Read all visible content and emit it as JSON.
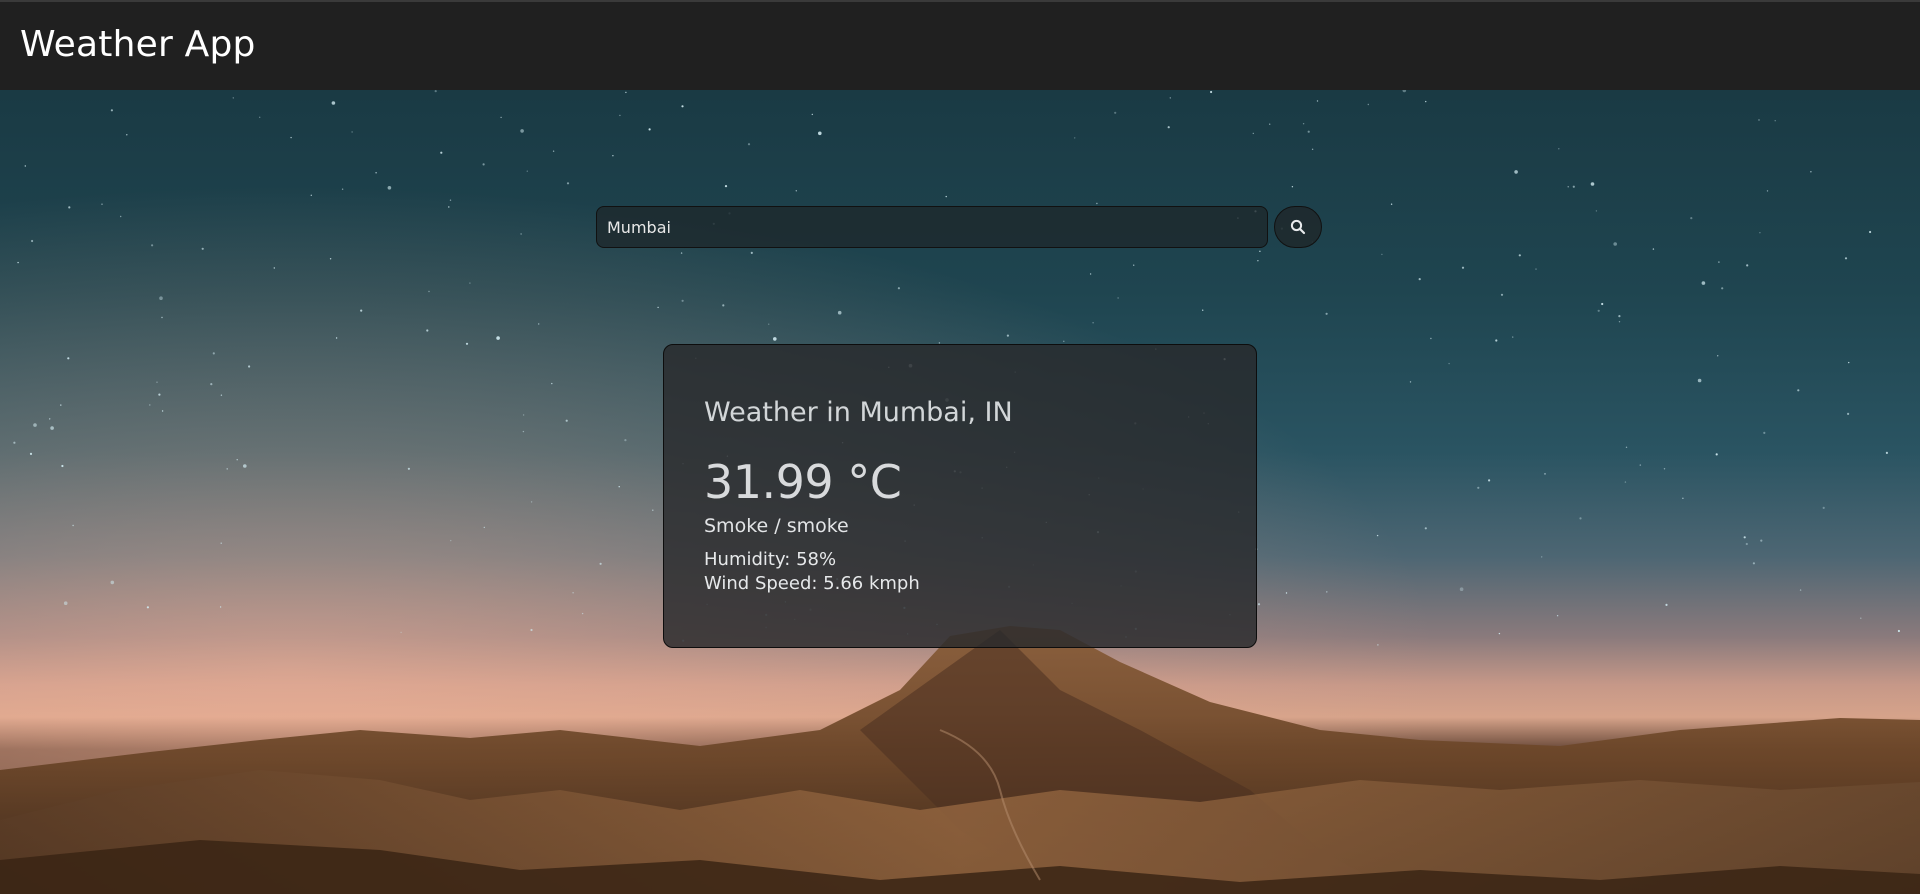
{
  "header": {
    "title": "Weather App"
  },
  "search": {
    "value": "Mumbai",
    "button_icon": "search-icon"
  },
  "weather": {
    "title": "Weather in Mumbai, IN",
    "temperature": "31.99 °C",
    "description": "Smoke / smoke",
    "humidity": "Humidity: 58%",
    "wind": "Wind Speed: 5.66 kmph"
  },
  "colors": {
    "header_bg": "#202020",
    "card_bg": "#28292c",
    "sky": "#1f4550",
    "horizon": "#d6a38a",
    "mountains": "#7a5232"
  }
}
